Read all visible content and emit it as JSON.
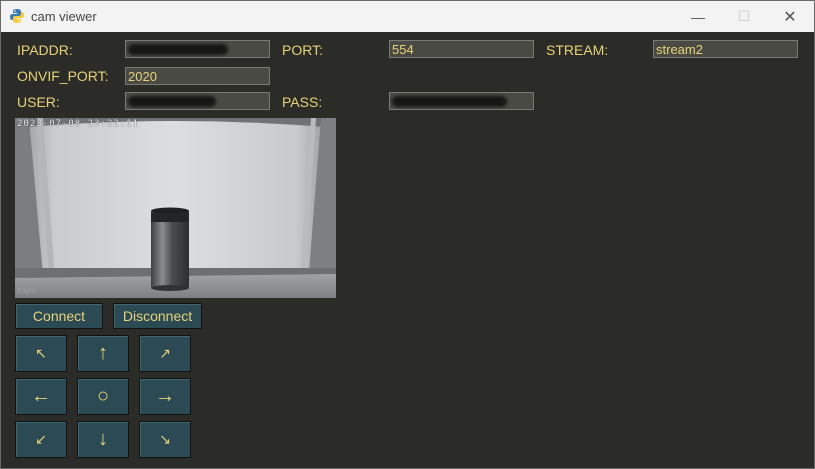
{
  "window": {
    "title": "cam viewer",
    "minimize_glyph": "—",
    "maximize_glyph": "☐",
    "close_glyph": "✕"
  },
  "form": {
    "ipaddr_label": "IPADDR:",
    "ipaddr_value": "",
    "port_label": "PORT:",
    "port_value": "554",
    "stream_label": "STREAM:",
    "stream_value": "stream2",
    "onvif_port_label": "ONVIF_PORT:",
    "onvif_port_value": "2020",
    "user_label": "USER:",
    "user_value": "",
    "pass_label": "PASS:",
    "pass_value": ""
  },
  "camera": {
    "timestamp": "2023-07-08 23:22:11",
    "watermark": "tapo"
  },
  "buttons": {
    "connect": "Connect",
    "disconnect": "Disconnect"
  },
  "ptz": {
    "up_left": "↖",
    "up": "↑",
    "up_right": "↗",
    "left": "←",
    "home": "○",
    "right": "→",
    "down_left": "↙",
    "down": "↓",
    "down_right": "↘"
  }
}
